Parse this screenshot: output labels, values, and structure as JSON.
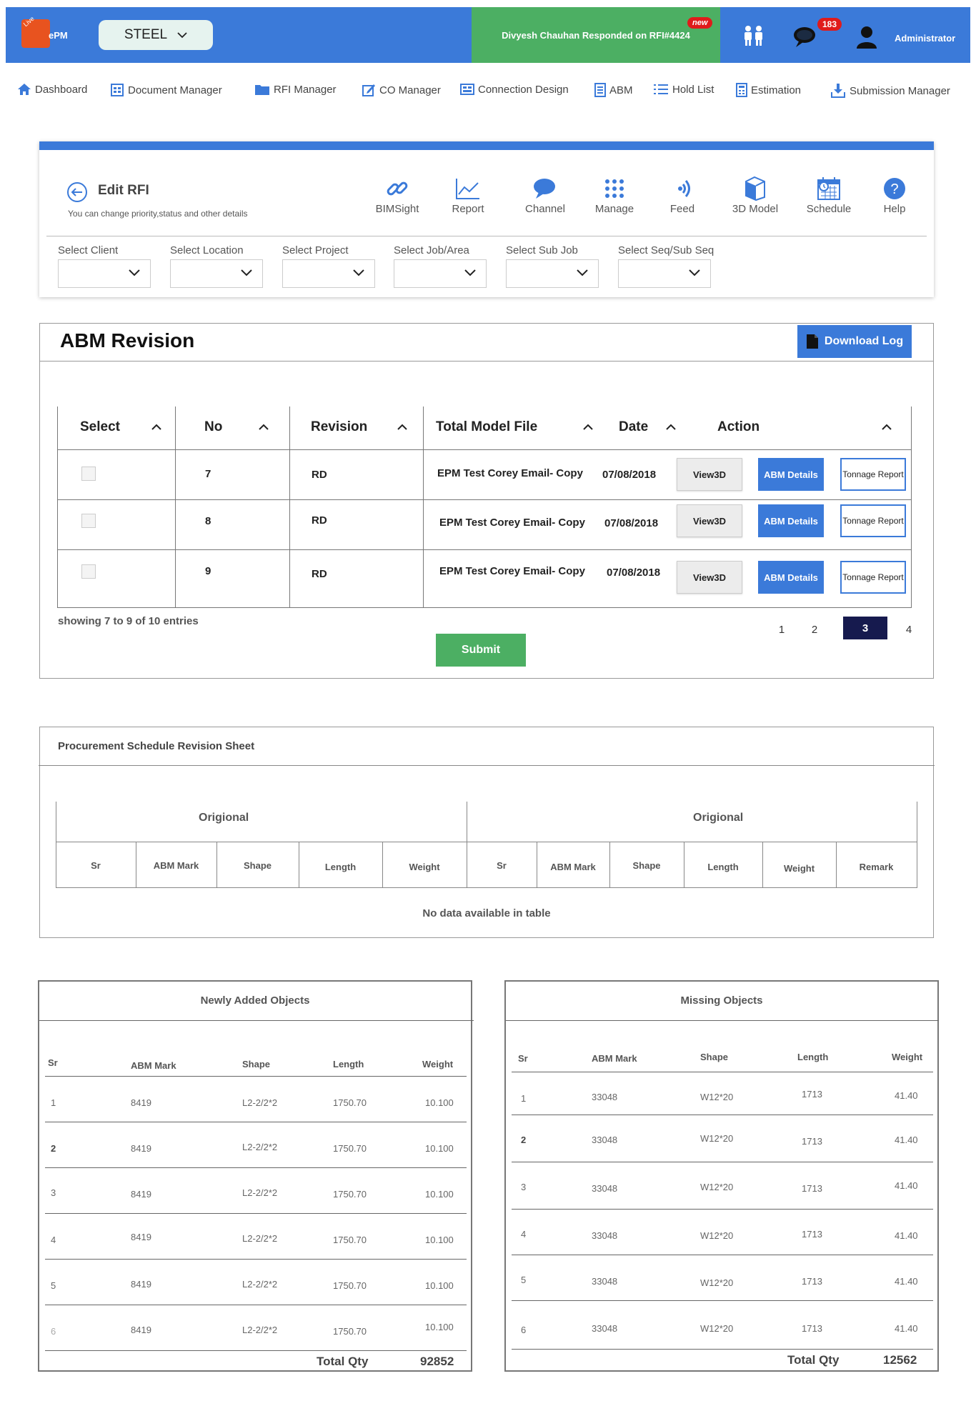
{
  "header": {
    "logo_text": "ePM",
    "logo_tag": "Live",
    "project_select": "STEEL",
    "notification": "Divyesh Chauhan Responded on RFI#4424",
    "notification_badge": "new",
    "messages_count": "183",
    "user": "Administrator",
    "color": "#3b7ad9"
  },
  "nav": {
    "dashboard": "Dashboard",
    "document_manager": "Document Manager",
    "rfi_manager": "RFI Manager",
    "co_manager": "CO Manager",
    "connection_design": "Connection Design",
    "abm": "ABM",
    "hold_list": "Hold List",
    "estimation": "Estimation",
    "submission_manager": "Submission Manager"
  },
  "rfi": {
    "title": "Edit RFI",
    "subtitle": "You can change priority,status and other details",
    "tools": {
      "bimsight": "BIMSight",
      "report": "Report",
      "channel": "Channel",
      "manage": "Manage",
      "feed": "Feed",
      "model3d": "3D Model",
      "schedule": "Schedule",
      "help": "Help"
    },
    "filters": {
      "client": "Select Client",
      "location": "Select Location",
      "project": "Select Project",
      "job": "Select Job/Area",
      "subjob": "Select Sub Job",
      "seq": "Select Seq/Sub Seq"
    }
  },
  "abm_revision": {
    "title": "ABM Revision",
    "download_label": "Download Log",
    "columns": {
      "select": "Select",
      "no": "No",
      "revision": "Revision",
      "total_model_file": "Total Model File",
      "date": "Date",
      "action": "Action"
    },
    "rows": [
      {
        "no": "7",
        "revision": "RD",
        "file": "EPM Test Corey Email- Copy",
        "date": "07/08/2018"
      },
      {
        "no": "8",
        "revision": "RD",
        "file": "EPM Test Corey Email- Copy",
        "date": "07/08/2018"
      },
      {
        "no": "9",
        "revision": "RD",
        "file": "EPM Test Corey Email- Copy",
        "date": "07/08/2018"
      }
    ],
    "actions": {
      "view3d": "View3D",
      "abm_details": "ABM Details",
      "tonnage_report": "Tonnage Report"
    },
    "showing": "showing 7 to 9 of 10 entries",
    "submit": "Submit",
    "pages": [
      "1",
      "2",
      "3",
      "4"
    ],
    "active_page": "3"
  },
  "procurement": {
    "title": "Procurement Schedule Revision Sheet",
    "group_left": "Origional",
    "group_right": "Origional",
    "columns_left": [
      "Sr",
      "ABM Mark",
      "Shape",
      "Length",
      "Weight"
    ],
    "columns_right": [
      "Sr",
      "ABM Mark",
      "Shape",
      "Length",
      "Weight",
      "Remark"
    ],
    "empty": "No data available in table"
  },
  "newly_added": {
    "title": "Newly Added Objects",
    "columns": [
      "Sr",
      "ABM Mark",
      "Shape",
      "Length",
      "Weight"
    ],
    "rows": [
      [
        "1",
        "8419",
        "L2-2/2*2",
        "1750.70",
        "10.100"
      ],
      [
        "2",
        "8419",
        "L2-2/2*2",
        "1750.70",
        "10.100"
      ],
      [
        "3",
        "8419",
        "L2-2/2*2",
        "1750.70",
        "10.100"
      ],
      [
        "4",
        "8419",
        "L2-2/2*2",
        "1750.70",
        "10.100"
      ],
      [
        "5",
        "8419",
        "L2-2/2*2",
        "1750.70",
        "10.100"
      ],
      [
        "6",
        "8419",
        "L2-2/2*2",
        "1750.70",
        "10.100"
      ]
    ],
    "total_label": "Total Qty",
    "total_value": "92852"
  },
  "missing": {
    "title": "Missing Objects",
    "columns": [
      "Sr",
      "ABM Mark",
      "Shape",
      "Length",
      "Weight"
    ],
    "rows": [
      [
        "1",
        "33048",
        "W12*20",
        "1713",
        "41.40"
      ],
      [
        "2",
        "33048",
        "W12*20",
        "1713",
        "41.40"
      ],
      [
        "3",
        "33048",
        "W12*20",
        "1713",
        "41.40"
      ],
      [
        "4",
        "33048",
        "W12*20",
        "1713",
        "41.40"
      ],
      [
        "5",
        "33048",
        "W12*20",
        "1713",
        "41.40"
      ],
      [
        "6",
        "33048",
        "W12*20",
        "1713",
        "41.40"
      ]
    ],
    "total_label": "Total Qty",
    "total_value": "12562"
  }
}
